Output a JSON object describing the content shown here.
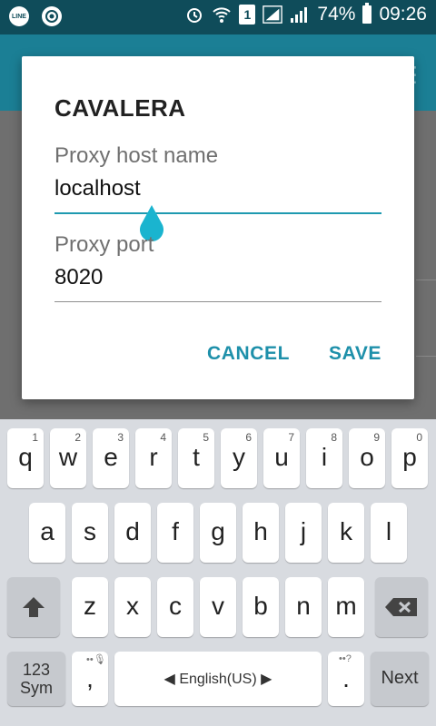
{
  "status_bar": {
    "left_icons": [
      "line-app-icon",
      "chrome-icon"
    ],
    "line_label": "LINE",
    "sim_label": "1",
    "battery": "74%",
    "time": "09:26"
  },
  "dialog": {
    "title": "CAVALERA",
    "host_label": "Proxy host name",
    "host_value": "localhost",
    "port_label": "Proxy port",
    "port_value": "8020",
    "cancel_label": "CANCEL",
    "save_label": "SAVE",
    "accent_color": "#1e9ab0"
  },
  "keyboard": {
    "row1": [
      {
        "ch": "q",
        "num": "1"
      },
      {
        "ch": "w",
        "num": "2"
      },
      {
        "ch": "e",
        "num": "3"
      },
      {
        "ch": "r",
        "num": "4"
      },
      {
        "ch": "t",
        "num": "5"
      },
      {
        "ch": "y",
        "num": "6"
      },
      {
        "ch": "u",
        "num": "7"
      },
      {
        "ch": "i",
        "num": "8"
      },
      {
        "ch": "o",
        "num": "9"
      },
      {
        "ch": "p",
        "num": "0"
      }
    ],
    "row2": [
      "a",
      "s",
      "d",
      "f",
      "g",
      "h",
      "j",
      "k",
      "l"
    ],
    "row3": [
      "z",
      "x",
      "c",
      "v",
      "b",
      "n",
      "m"
    ],
    "sym_line1": "123",
    "sym_line2": "Sym",
    "comma": ",",
    "language": "English(US)",
    "period": ".",
    "next": "Next"
  }
}
